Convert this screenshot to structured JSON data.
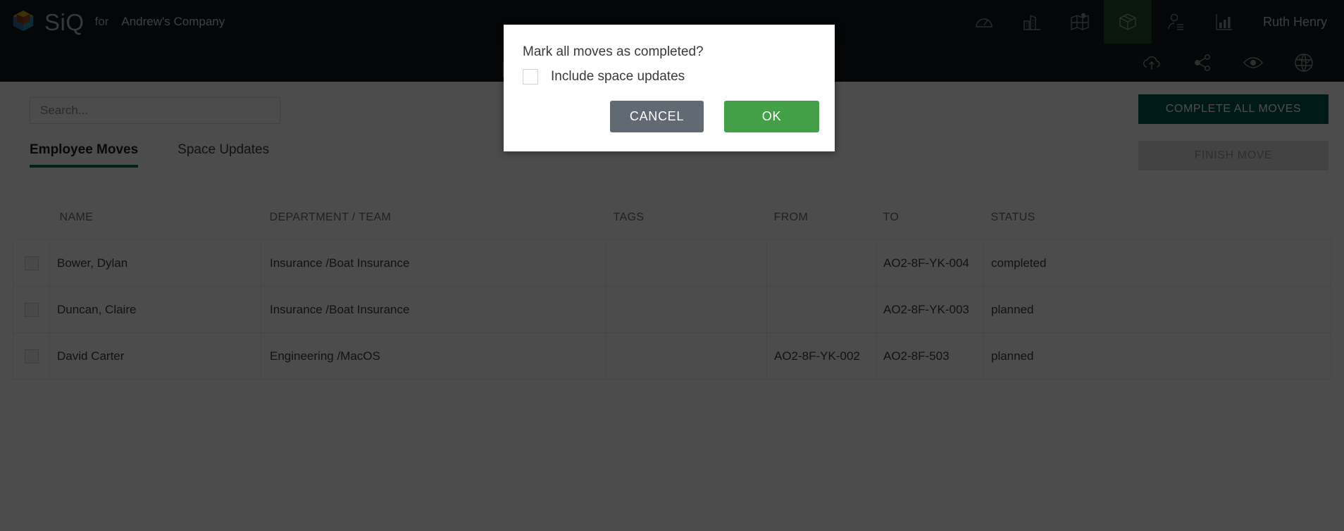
{
  "header": {
    "logo_name": "cube-logo",
    "brand": "SiQ",
    "for_label": "for",
    "company": "Andrew's Company",
    "username": "Ruth Henry",
    "nav_icons": [
      {
        "name": "dashboard-gauge-icon",
        "label": "Dashboard",
        "active": false
      },
      {
        "name": "buildings-icon",
        "label": "Buildings",
        "active": false
      },
      {
        "name": "map-icon",
        "label": "Map",
        "active": false
      },
      {
        "name": "box-move-icon",
        "label": "Moves",
        "active": true
      },
      {
        "name": "employee-icon",
        "label": "Employees",
        "active": false
      },
      {
        "name": "bar-chart-icon",
        "label": "Reports",
        "active": false
      }
    ]
  },
  "subbar": {
    "icons": [
      {
        "name": "cloud-upload-icon",
        "label": "Upload"
      },
      {
        "name": "share-icon",
        "label": "Share"
      },
      {
        "name": "eye-icon",
        "label": "View"
      },
      {
        "name": "globe-icon",
        "label": "Globe"
      }
    ],
    "fab_name": "more-options-fab"
  },
  "search": {
    "value": "",
    "placeholder": "Search..."
  },
  "tabs": [
    {
      "label": "Employee Moves",
      "active": true
    },
    {
      "label": "Space Updates",
      "active": false
    }
  ],
  "actions": {
    "complete_all_moves": "COMPLETE ALL MOVES",
    "finish_move": "FINISH MOVE"
  },
  "table": {
    "columns": [
      "NAME",
      "DEPARTMENT / TEAM",
      "TAGS",
      "FROM",
      "TO",
      "STATUS"
    ],
    "rows": [
      {
        "name": "Bower, Dylan",
        "department": "Insurance /Boat Insurance",
        "tags": "",
        "from": "",
        "to": "AO2-8F-YK-004",
        "status": "completed"
      },
      {
        "name": "Duncan, Claire",
        "department": "Insurance /Boat Insurance",
        "tags": "",
        "from": "",
        "to": "AO2-8F-YK-003",
        "status": "planned"
      },
      {
        "name": "David Carter",
        "department": "Engineering /MacOS",
        "tags": "",
        "from": "AO2-8F-YK-002",
        "to": "AO2-8F-503",
        "status": "planned"
      }
    ]
  },
  "modal": {
    "title": "Mark all moves as completed?",
    "checkbox_label": "Include space updates",
    "checkbox_checked": false,
    "cancel_label": "CANCEL",
    "ok_label": "OK"
  },
  "colors": {
    "topbar": "#12171a",
    "subbar": "#15191c",
    "active_nav": "#1e5026",
    "tab_underline": "#0f6b4f",
    "primary_button": "#015c4e",
    "ok_button": "#43a047",
    "cancel_button": "#616972",
    "overlay": "rgba(0,0,0,0.70)"
  }
}
